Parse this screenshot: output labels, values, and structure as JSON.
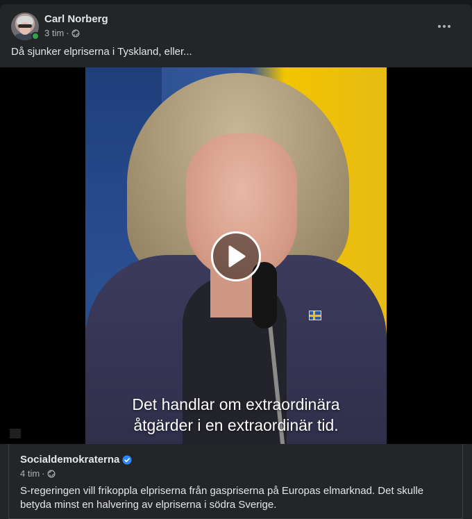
{
  "post": {
    "author": "Carl Norberg",
    "time": "3 tim",
    "separator": "·",
    "text": "Då sjunker elpriserna i Tyskland, eller..."
  },
  "video": {
    "caption_line1": "Det handlar om extraordinära",
    "caption_line2": "åtgärder i en extraordinär tid."
  },
  "shared": {
    "author": "Socialdemokraterna",
    "time": "4 tim",
    "separator": "·",
    "text": "S-regeringen vill frikoppla elpriserna från gaspriserna på Europas elmarknad. Det skulle betyda minst en halvering av elpriserna i södra Sverige."
  },
  "icons": {
    "audience": "globe-icon",
    "verified": "verified-badge-icon",
    "more": "more-options-icon",
    "play": "play-icon"
  },
  "colors": {
    "card_bg": "#242526",
    "online": "#31a24c",
    "verified": "#2d88ff"
  }
}
